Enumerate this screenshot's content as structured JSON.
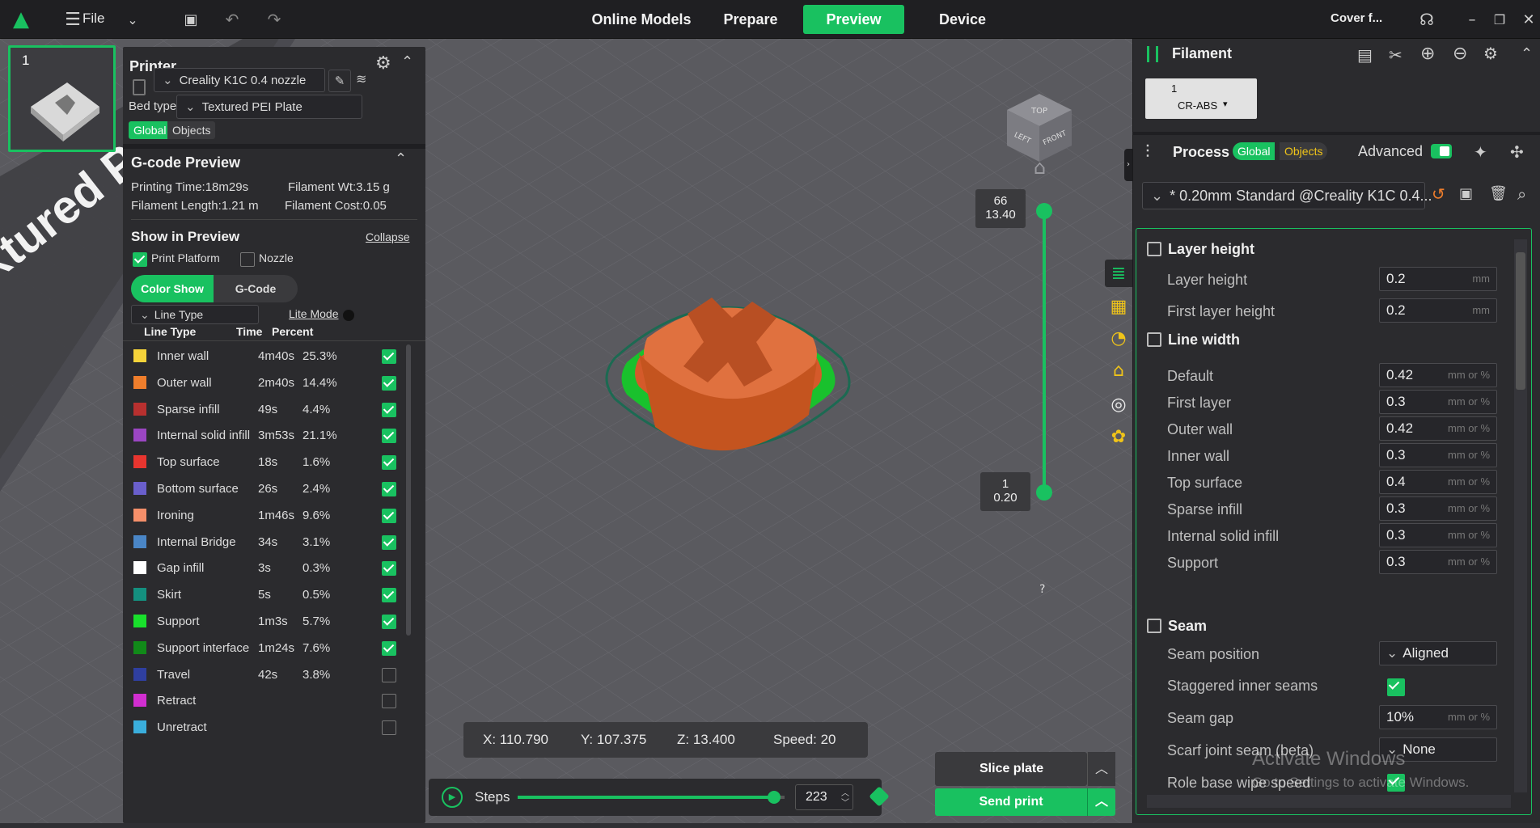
{
  "topbar": {
    "file_label": "File",
    "tabs": [
      "Online Models",
      "Prepare",
      "Preview",
      "Device"
    ],
    "active_tab": "Preview",
    "cover_label": "Cover f..."
  },
  "plate": {
    "number": "1",
    "bed_text": "xtured PEI Plate"
  },
  "printer": {
    "title": "Printer",
    "name": "Creality K1C 0.4 nozzle",
    "bed_type_label": "Bed type",
    "bed_type_value": "Textured PEI Plate",
    "scope_global": "Global",
    "scope_objects": "Objects"
  },
  "gcode": {
    "title": "G-code Preview",
    "printing_time": "Printing Time:18m29s",
    "filament_wt": "Filament Wt:3.15 g",
    "filament_length": "Filament Length:1.21 m",
    "filament_cost": "Filament Cost:0.05",
    "show_in_preview": "Show in Preview",
    "collapse": "Collapse",
    "print_platform": "Print Platform",
    "nozzle": "Nozzle",
    "color_show": "Color Show",
    "gcode_tab": "G-Code",
    "view_select": "Line Type",
    "lite_mode": "Lite Mode",
    "columns": [
      "Line Type",
      "Time",
      "Percent"
    ],
    "rows": [
      {
        "name": "Inner wall",
        "time": "4m40s",
        "pct": "25.3%",
        "color": "#f5d33a",
        "on": true
      },
      {
        "name": "Outer wall",
        "time": "2m40s",
        "pct": "14.4%",
        "color": "#ef7e2c",
        "on": true
      },
      {
        "name": "Sparse infill",
        "time": "49s",
        "pct": "4.4%",
        "color": "#b8302f",
        "on": true
      },
      {
        "name": "Internal solid infill",
        "time": "3m53s",
        "pct": "21.1%",
        "color": "#9b46c3",
        "on": true
      },
      {
        "name": "Top surface",
        "time": "18s",
        "pct": "1.6%",
        "color": "#e8352f",
        "on": true
      },
      {
        "name": "Bottom surface",
        "time": "26s",
        "pct": "2.4%",
        "color": "#6a5fcc",
        "on": true
      },
      {
        "name": "Ironing",
        "time": "1m46s",
        "pct": "9.6%",
        "color": "#f58f6a",
        "on": true
      },
      {
        "name": "Internal Bridge",
        "time": "34s",
        "pct": "3.1%",
        "color": "#4a86c7",
        "on": true
      },
      {
        "name": "Gap infill",
        "time": "3s",
        "pct": "0.3%",
        "color": "#ffffff",
        "on": true
      },
      {
        "name": "Skirt",
        "time": "5s",
        "pct": "0.5%",
        "color": "#14907f",
        "on": true
      },
      {
        "name": "Support",
        "time": "1m3s",
        "pct": "5.7%",
        "color": "#19e02c",
        "on": true
      },
      {
        "name": "Support interface",
        "time": "1m24s",
        "pct": "7.6%",
        "color": "#118a19",
        "on": true
      },
      {
        "name": "Travel",
        "time": "42s",
        "pct": "3.8%",
        "color": "#2f3fa0",
        "on": false
      },
      {
        "name": "Retract",
        "time": "",
        "pct": "",
        "color": "#d12ed0",
        "on": false
      },
      {
        "name": "Unretract",
        "time": "",
        "pct": "",
        "color": "#3aaedc",
        "on": false
      }
    ]
  },
  "layer_slider": {
    "top_layer": "66",
    "top_height": "13.40",
    "bottom_layer": "1",
    "bottom_height": "0.20",
    "help": "?"
  },
  "coords": {
    "x": "X: 110.790",
    "y": "Y: 107.375",
    "z": "Z: 13.400",
    "speed": "Speed: 20"
  },
  "steps": {
    "label": "Steps",
    "value": "223",
    "progress": 0.96
  },
  "actions": {
    "slice": "Slice plate",
    "send": "Send print"
  },
  "filament": {
    "title": "Filament",
    "slot_number": "1",
    "slot_type": "CR-ABS"
  },
  "process": {
    "title": "Process",
    "global": "Global",
    "objects": "Objects",
    "advanced": "Advanced",
    "preset": "* 0.20mm Standard @Creality K1C 0.4..."
  },
  "settings": {
    "layer_height_section": "Layer height",
    "layer_height": {
      "label": "Layer height",
      "value": "0.2",
      "unit": "mm"
    },
    "first_layer_height": {
      "label": "First layer height",
      "value": "0.2",
      "unit": "mm"
    },
    "line_width_section": "Line width",
    "line_widths": [
      {
        "label": "Default",
        "value": "0.42",
        "unit": "mm or %"
      },
      {
        "label": "First layer",
        "value": "0.3",
        "unit": "mm or %"
      },
      {
        "label": "Outer wall",
        "value": "0.42",
        "unit": "mm or %"
      },
      {
        "label": "Inner wall",
        "value": "0.3",
        "unit": "mm or %"
      },
      {
        "label": "Top surface",
        "value": "0.4",
        "unit": "mm or %"
      },
      {
        "label": "Sparse infill",
        "value": "0.3",
        "unit": "mm or %"
      },
      {
        "label": "Internal solid infill",
        "value": "0.3",
        "unit": "mm or %"
      },
      {
        "label": "Support",
        "value": "0.3",
        "unit": "mm or %"
      }
    ],
    "seam_section": "Seam",
    "seam_position": {
      "label": "Seam position",
      "value": "Aligned"
    },
    "staggered": {
      "label": "Staggered inner seams"
    },
    "seam_gap": {
      "label": "Seam gap",
      "value": "10%",
      "unit": "mm or %"
    },
    "scarf": {
      "label": "Scarf joint seam (beta)",
      "value": "None"
    },
    "role_wipe": {
      "label": "Role base wipe speed"
    }
  },
  "watermark": {
    "line1": "Activate Windows",
    "line2": "Go to Settings to activate Windows."
  }
}
